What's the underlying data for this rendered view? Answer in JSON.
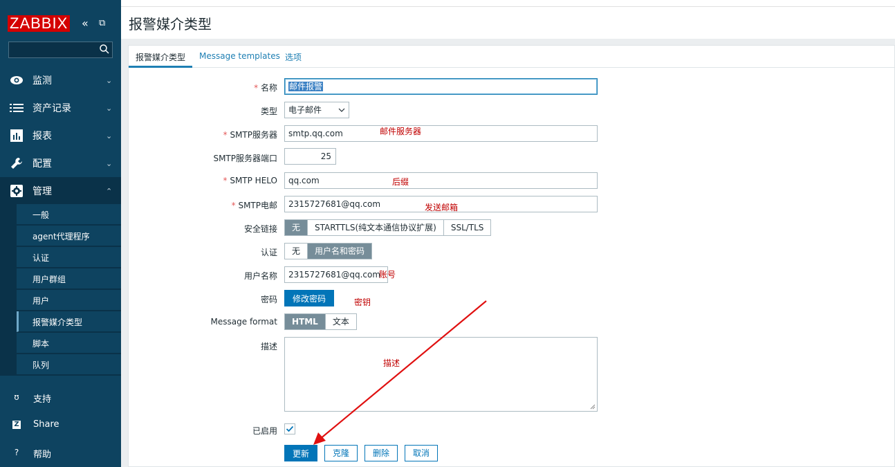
{
  "sidebar": {
    "logo": "ZABBIX",
    "collapse_symbol": "«",
    "kiosk_symbol": "⧉",
    "menu": [
      {
        "label": "监测",
        "icon": "eye-icon",
        "chevron": "⌄"
      },
      {
        "label": "资产记录",
        "icon": "list-icon",
        "chevron": "⌄"
      },
      {
        "label": "报表",
        "icon": "bar-chart-icon",
        "chevron": "⌄"
      },
      {
        "label": "配置",
        "icon": "wrench-icon",
        "chevron": "⌄"
      },
      {
        "label": "管理",
        "icon": "gear-icon",
        "chevron": "⌃"
      }
    ],
    "submenu": [
      {
        "label": "一般"
      },
      {
        "label": "agent代理程序"
      },
      {
        "label": "认证"
      },
      {
        "label": "用户群组"
      },
      {
        "label": "用户"
      },
      {
        "label": "报警媒介类型"
      },
      {
        "label": "脚本"
      },
      {
        "label": "队列"
      }
    ],
    "bottom": [
      {
        "label": "支持",
        "icon": "headset-icon",
        "glyph": "ʊ"
      },
      {
        "label": "Share",
        "icon": "share-icon",
        "glyph": "Z"
      },
      {
        "label": "帮助",
        "icon": "help-icon",
        "glyph": "?"
      }
    ]
  },
  "page": {
    "title": "报警媒介类型"
  },
  "tabs": [
    {
      "label": "报警媒介类型"
    },
    {
      "label": "Message templates"
    },
    {
      "label": "选项"
    }
  ],
  "form": {
    "name_label": "名称",
    "name_value": "邮件报警",
    "type_label": "类型",
    "type_value": "电子邮件",
    "smtp_server_label": "SMTP服务器",
    "smtp_server_value": "smtp.qq.com",
    "smtp_port_label": "SMTP服务器端口",
    "smtp_port_value": "25",
    "smtp_helo_label": "SMTP HELO",
    "smtp_helo_value": "qq.com",
    "smtp_email_label": "SMTP电邮",
    "smtp_email_value": "2315727681@qq.com",
    "security_label": "安全链接",
    "security_options": [
      "无",
      "STARTTLS(纯文本通信协议扩展)",
      "SSL/TLS"
    ],
    "auth_label": "认证",
    "auth_options": [
      "无",
      "用户名和密码"
    ],
    "username_label": "用户名称",
    "username_value": "2315727681@qq.com",
    "password_label": "密码",
    "password_button": "修改密码",
    "format_label": "Message format",
    "format_options": [
      "HTML",
      "文本"
    ],
    "description_label": "描述",
    "enabled_label": "已启用",
    "required_mark": "*"
  },
  "annotations": {
    "server": "邮件服务器",
    "helo": "后缀",
    "email": "发送邮箱",
    "username": "账号",
    "password": "密钥",
    "description": "描述"
  },
  "buttons": {
    "update": "更新",
    "clone": "克隆",
    "delete": "删除",
    "cancel": "取消"
  },
  "colors": {
    "sidebar_bg": "#0e4360",
    "logo_bg": "#d40000",
    "primary": "#0275b8",
    "annotation": "#c00000",
    "arrow": "#e01010"
  }
}
